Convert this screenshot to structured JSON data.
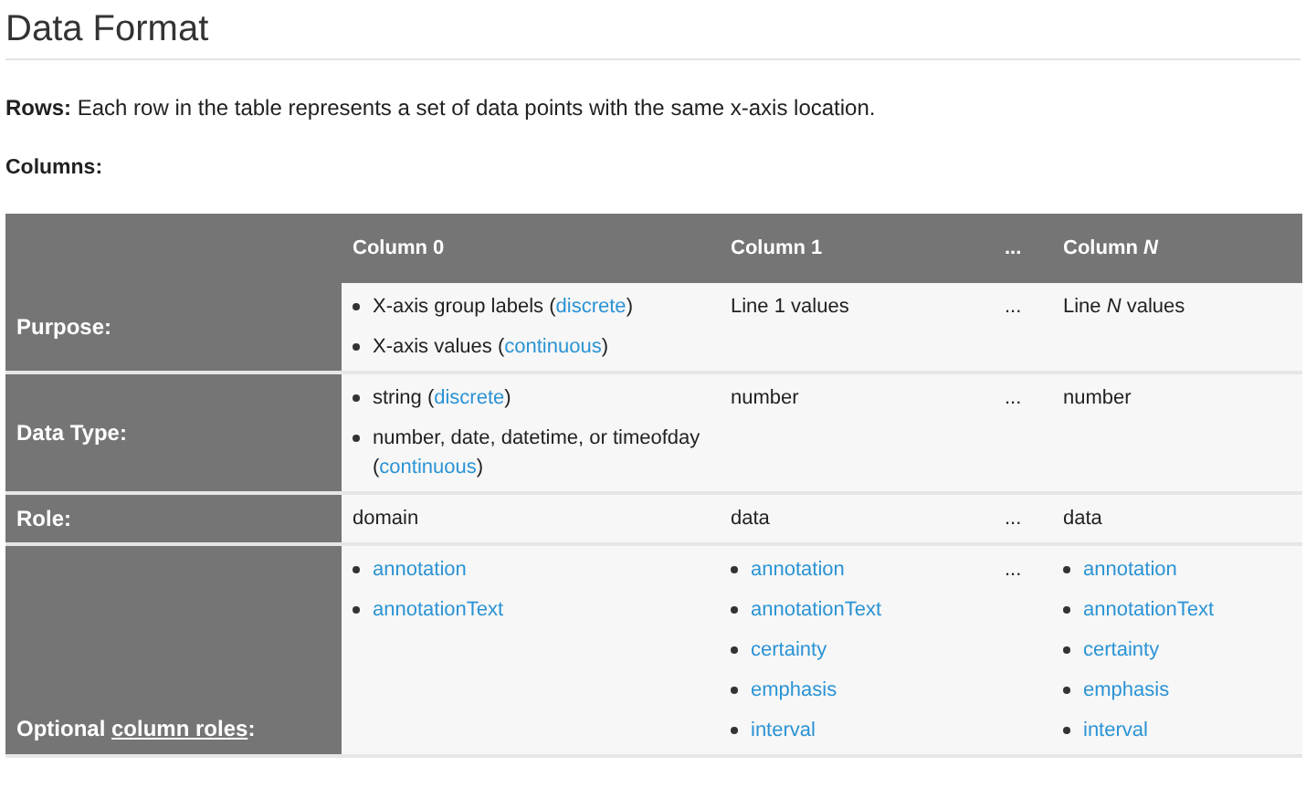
{
  "heading": "Data Format",
  "rows_note": "**Rows:** Each row in the table represents a set of data points with the same x-axis location.",
  "columns_label": "Columns:",
  "table": {
    "columns": [
      "Column 0",
      "Column 1",
      "...",
      "Column *N*"
    ],
    "rows": [
      {
        "label": {
          "text": "Purpose:"
        },
        "cells": [
          {
            "kind": "list",
            "items": [
              {
                "text": "X-axis group labels (",
                "link": "discrete",
                "tail": ")"
              },
              {
                "text": "X-axis values (",
                "link": "continuous",
                "tail": ")"
              }
            ]
          },
          {
            "kind": "text",
            "text": "Line 1 values"
          },
          {
            "kind": "text",
            "text": "..."
          },
          {
            "kind": "text",
            "text": "Line *N* values"
          }
        ]
      },
      {
        "label": {
          "text": "Data Type:"
        },
        "cells": [
          {
            "kind": "list",
            "items": [
              {
                "text": "string (",
                "link": "discrete",
                "tail": ")"
              },
              {
                "text": "number, date, datetime, or timeofday (",
                "link": "continuous",
                "tail": ")"
              }
            ]
          },
          {
            "kind": "text",
            "text": "number"
          },
          {
            "kind": "text",
            "text": "..."
          },
          {
            "kind": "text",
            "text": "number"
          }
        ]
      },
      {
        "label": {
          "text": "Role:"
        },
        "cells": [
          {
            "kind": "text",
            "text": "domain"
          },
          {
            "kind": "text",
            "text": "data"
          },
          {
            "kind": "text",
            "text": "..."
          },
          {
            "kind": "text",
            "text": "data"
          }
        ]
      },
      {
        "label": {
          "text": "Optional ",
          "link": "column roles",
          "tail": ":"
        },
        "cells": [
          {
            "kind": "list",
            "items": [
              {
                "link": "annotation"
              },
              {
                "link": "annotationText"
              }
            ]
          },
          {
            "kind": "list",
            "items": [
              {
                "link": "annotation"
              },
              {
                "link": "annotationText"
              },
              {
                "link": "certainty"
              },
              {
                "link": "emphasis"
              },
              {
                "link": "interval"
              }
            ]
          },
          {
            "kind": "text",
            "text": "..."
          },
          {
            "kind": "list",
            "items": [
              {
                "link": "annotation"
              },
              {
                "link": "annotationText"
              },
              {
                "link": "certainty"
              },
              {
                "link": "emphasis"
              },
              {
                "link": "interval"
              }
            ]
          }
        ]
      }
    ]
  }
}
